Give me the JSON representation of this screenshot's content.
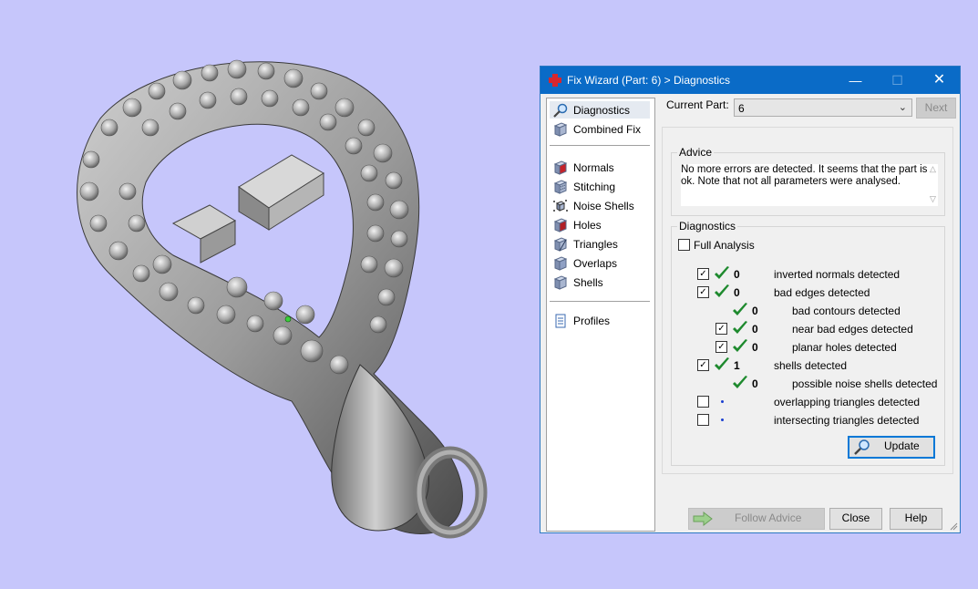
{
  "window": {
    "title": "Fix Wizard (Part: 6) > Diagnostics",
    "minimize_icon": "minimize-icon",
    "maximize_icon": "maximize-icon",
    "close_icon": "close-icon"
  },
  "nav": {
    "top_items": [
      {
        "label": "Diagnostics",
        "icon": "magnifier-icon",
        "selected": true
      },
      {
        "label": "Combined Fix",
        "icon": "cube-icon"
      }
    ],
    "tool_items": [
      {
        "label": "Normals",
        "icon": "normals-cube-icon"
      },
      {
        "label": "Stitching",
        "icon": "stitching-cube-icon"
      },
      {
        "label": "Noise Shells",
        "icon": "noise-shells-icon"
      },
      {
        "label": "Holes",
        "icon": "holes-cube-icon"
      },
      {
        "label": "Triangles",
        "icon": "triangles-cube-icon"
      },
      {
        "label": "Overlaps",
        "icon": "overlaps-cube-icon"
      },
      {
        "label": "Shells",
        "icon": "shells-cube-icon"
      }
    ],
    "bottom_items": [
      {
        "label": "Profiles",
        "icon": "profiles-document-icon"
      }
    ]
  },
  "current_part": {
    "label": "Current Part:",
    "value": "6",
    "next_label": "Next"
  },
  "advice": {
    "title": "Advice",
    "text": "No more errors are detected. It seems that the part is ok. Note that not all parameters were analysed."
  },
  "diagnostics": {
    "title": "Diagnostics",
    "full_analysis_label": "Full Analysis",
    "full_analysis_checked": false,
    "rows": [
      {
        "checkbox": true,
        "checked": true,
        "status": "ok",
        "count": "0",
        "label": "inverted normals detected",
        "indent": 0
      },
      {
        "checkbox": true,
        "checked": true,
        "status": "ok",
        "count": "0",
        "label": "bad edges detected",
        "indent": 0
      },
      {
        "checkbox": false,
        "checked": false,
        "status": "ok",
        "count": "0",
        "label": "bad contours detected",
        "indent": 1
      },
      {
        "checkbox": true,
        "checked": true,
        "status": "ok",
        "count": "0",
        "label": "near bad edges detected",
        "indent": 1
      },
      {
        "checkbox": true,
        "checked": true,
        "status": "ok",
        "count": "0",
        "label": "planar holes detected",
        "indent": 1
      },
      {
        "checkbox": true,
        "checked": true,
        "status": "ok",
        "count": "1",
        "label": "shells detected",
        "indent": 0
      },
      {
        "checkbox": false,
        "checked": false,
        "status": "ok",
        "count": "0",
        "label": "possible noise shells detected",
        "indent": 1
      },
      {
        "checkbox": true,
        "checked": false,
        "status": "pending",
        "count": "",
        "label": "overlapping triangles detected",
        "indent": 0
      },
      {
        "checkbox": true,
        "checked": false,
        "status": "pending",
        "count": "",
        "label": "intersecting triangles detected",
        "indent": 0
      }
    ],
    "update_label": "Update"
  },
  "footer": {
    "follow_advice_label": "Follow Advice",
    "close_label": "Close",
    "help_label": "Help"
  },
  "colors": {
    "background": "#c6c6fb",
    "titlebar": "#0a6bc7",
    "check_green": "#1e8a2e",
    "pending_dot": "#1a3fd0"
  }
}
